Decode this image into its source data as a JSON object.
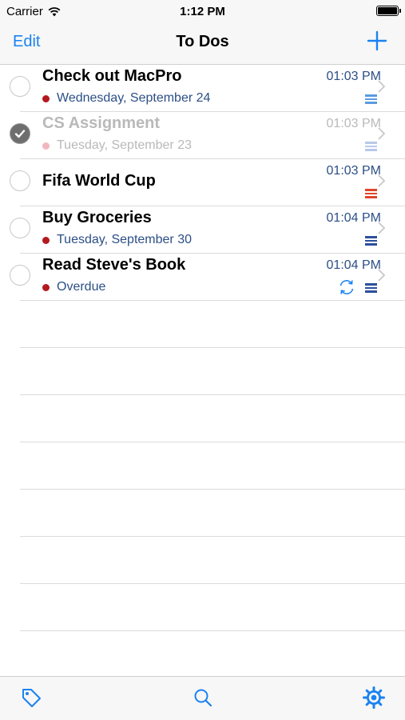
{
  "status_bar": {
    "carrier": "Carrier",
    "time": "1:12 PM"
  },
  "nav": {
    "edit_label": "Edit",
    "title": "To Dos",
    "add_icon": "plus-icon"
  },
  "todos": [
    {
      "title": "Check out MacPro",
      "subtitle": "Wednesday, September 24",
      "time": "01:03 PM",
      "completed": false,
      "priority_color": "#5b9be0",
      "repeat": false
    },
    {
      "title": "CS Assignment",
      "subtitle": "Tuesday, September 23",
      "time": "01:03 PM",
      "completed": true,
      "priority_color": "#b8c8e8",
      "repeat": false
    },
    {
      "title": "Fifa World Cup",
      "subtitle": "",
      "time": "01:03 PM",
      "completed": false,
      "priority_color": "#e0452a",
      "repeat": false
    },
    {
      "title": "Buy Groceries",
      "subtitle": "Tuesday, September 30",
      "time": "01:04 PM",
      "completed": false,
      "priority_color": "#2c4f9e",
      "repeat": false
    },
    {
      "title": "Read Steve's Book",
      "subtitle": "Overdue",
      "time": "01:04 PM",
      "completed": false,
      "priority_color": "#2c4f9e",
      "repeat": true
    }
  ],
  "tab_bar": {
    "items": [
      "tag-icon",
      "search-icon",
      "gear-icon"
    ]
  },
  "colors": {
    "accent": "#1a82f0",
    "date_text": "#2c4f86",
    "due_dot": "#b3191f"
  }
}
